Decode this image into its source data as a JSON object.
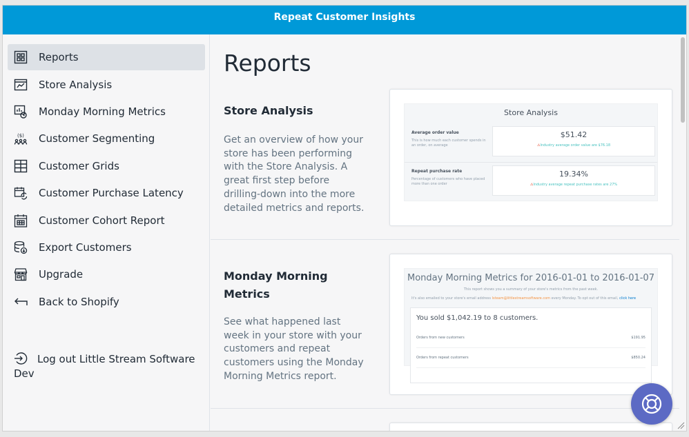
{
  "app": {
    "title": "Repeat Customer Insights"
  },
  "sidebar": {
    "items": [
      {
        "label": "Reports",
        "icon": "reports-icon"
      },
      {
        "label": "Store Analysis",
        "icon": "store-analysis-icon"
      },
      {
        "label": "Monday Morning Metrics",
        "icon": "metrics-icon"
      },
      {
        "label": "Customer Segmenting",
        "icon": "segmenting-icon"
      },
      {
        "label": "Customer Grids",
        "icon": "grid-icon"
      },
      {
        "label": "Customer Purchase Latency",
        "icon": "latency-icon"
      },
      {
        "label": "Customer Cohort Report",
        "icon": "calendar-icon"
      },
      {
        "label": "Export Customers",
        "icon": "export-icon"
      },
      {
        "label": "Upgrade",
        "icon": "store-icon"
      },
      {
        "label": "Back to Shopify",
        "icon": "back-arrow-icon"
      }
    ],
    "logout_label": "Log out Little Stream Software Dev"
  },
  "main": {
    "title": "Reports",
    "sections": [
      {
        "title": "Store Analysis",
        "description": "Get an overview of how your store has been performing with the Store Analysis. A great first step before drilling-down into the more detailed metrics and reports.",
        "preview": {
          "title": "Store Analysis",
          "rows": [
            {
              "label": "Average order value",
              "sub": "This is how much each customer spends in an order, on average",
              "value": "$51.42",
              "note": "Industry average order value are $76.18"
            },
            {
              "label": "Repeat purchase rate",
              "sub": "Percentage of customers who have placed more than one order",
              "value": "19.34%",
              "note": "Industry average repeat purchase rates are 27%"
            }
          ]
        }
      },
      {
        "title": "Monday Morning Metrics",
        "description": "See what happened last week in your store with your customers and repeat customers using the Monday Morning Metrics report.",
        "preview": {
          "title": "Monday Morning Metrics for 2016-01-01 to 2016-01-07",
          "line1": "This report shows you a summary of your store's metrics from the past week.",
          "line2_a": "It's also emailed to your store's email address",
          "line2_email": "lsteam@littlestreamsoftware.com",
          "line2_b": "every Monday. To opt out of this email,",
          "line2_link": "click here",
          "sold": "You sold $1,042.19 to 8 customers.",
          "rows": [
            {
              "label": "Orders from new customers",
              "value": "$191.95"
            },
            {
              "label": "Orders from repeat customers",
              "value": "$850.24"
            }
          ]
        }
      }
    ]
  },
  "help": {
    "icon": "lifebuoy-icon"
  }
}
